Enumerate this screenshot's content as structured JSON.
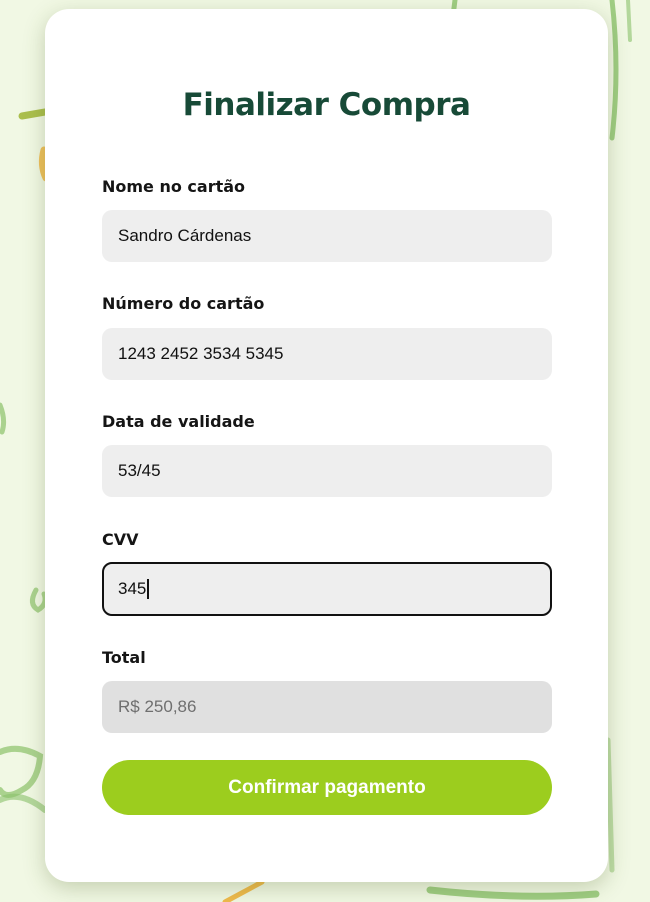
{
  "colors": {
    "background": "#f1f8e4",
    "card": "#ffffff",
    "title": "#174a37",
    "input_bg": "#eeeeee",
    "readonly_bg": "#e0e0e0",
    "button": "#9ccd1e",
    "decor_green": "#8bc26a",
    "decor_orange": "#f0b23a"
  },
  "checkout": {
    "title": "Finalizar Compra",
    "fields": [
      {
        "label": "Nome no cartão",
        "value": "Sandro Cárdenas"
      },
      {
        "label": "Número do cartão",
        "value": "1243 2452 3534 5345"
      },
      {
        "label": "Data de validade",
        "value": "53/45"
      },
      {
        "label": "CVV",
        "value": "345",
        "focused": true
      },
      {
        "label": "Total",
        "value": "R$ 250,86",
        "readonly": true
      }
    ],
    "confirm_label": "Confirmar pagamento"
  }
}
